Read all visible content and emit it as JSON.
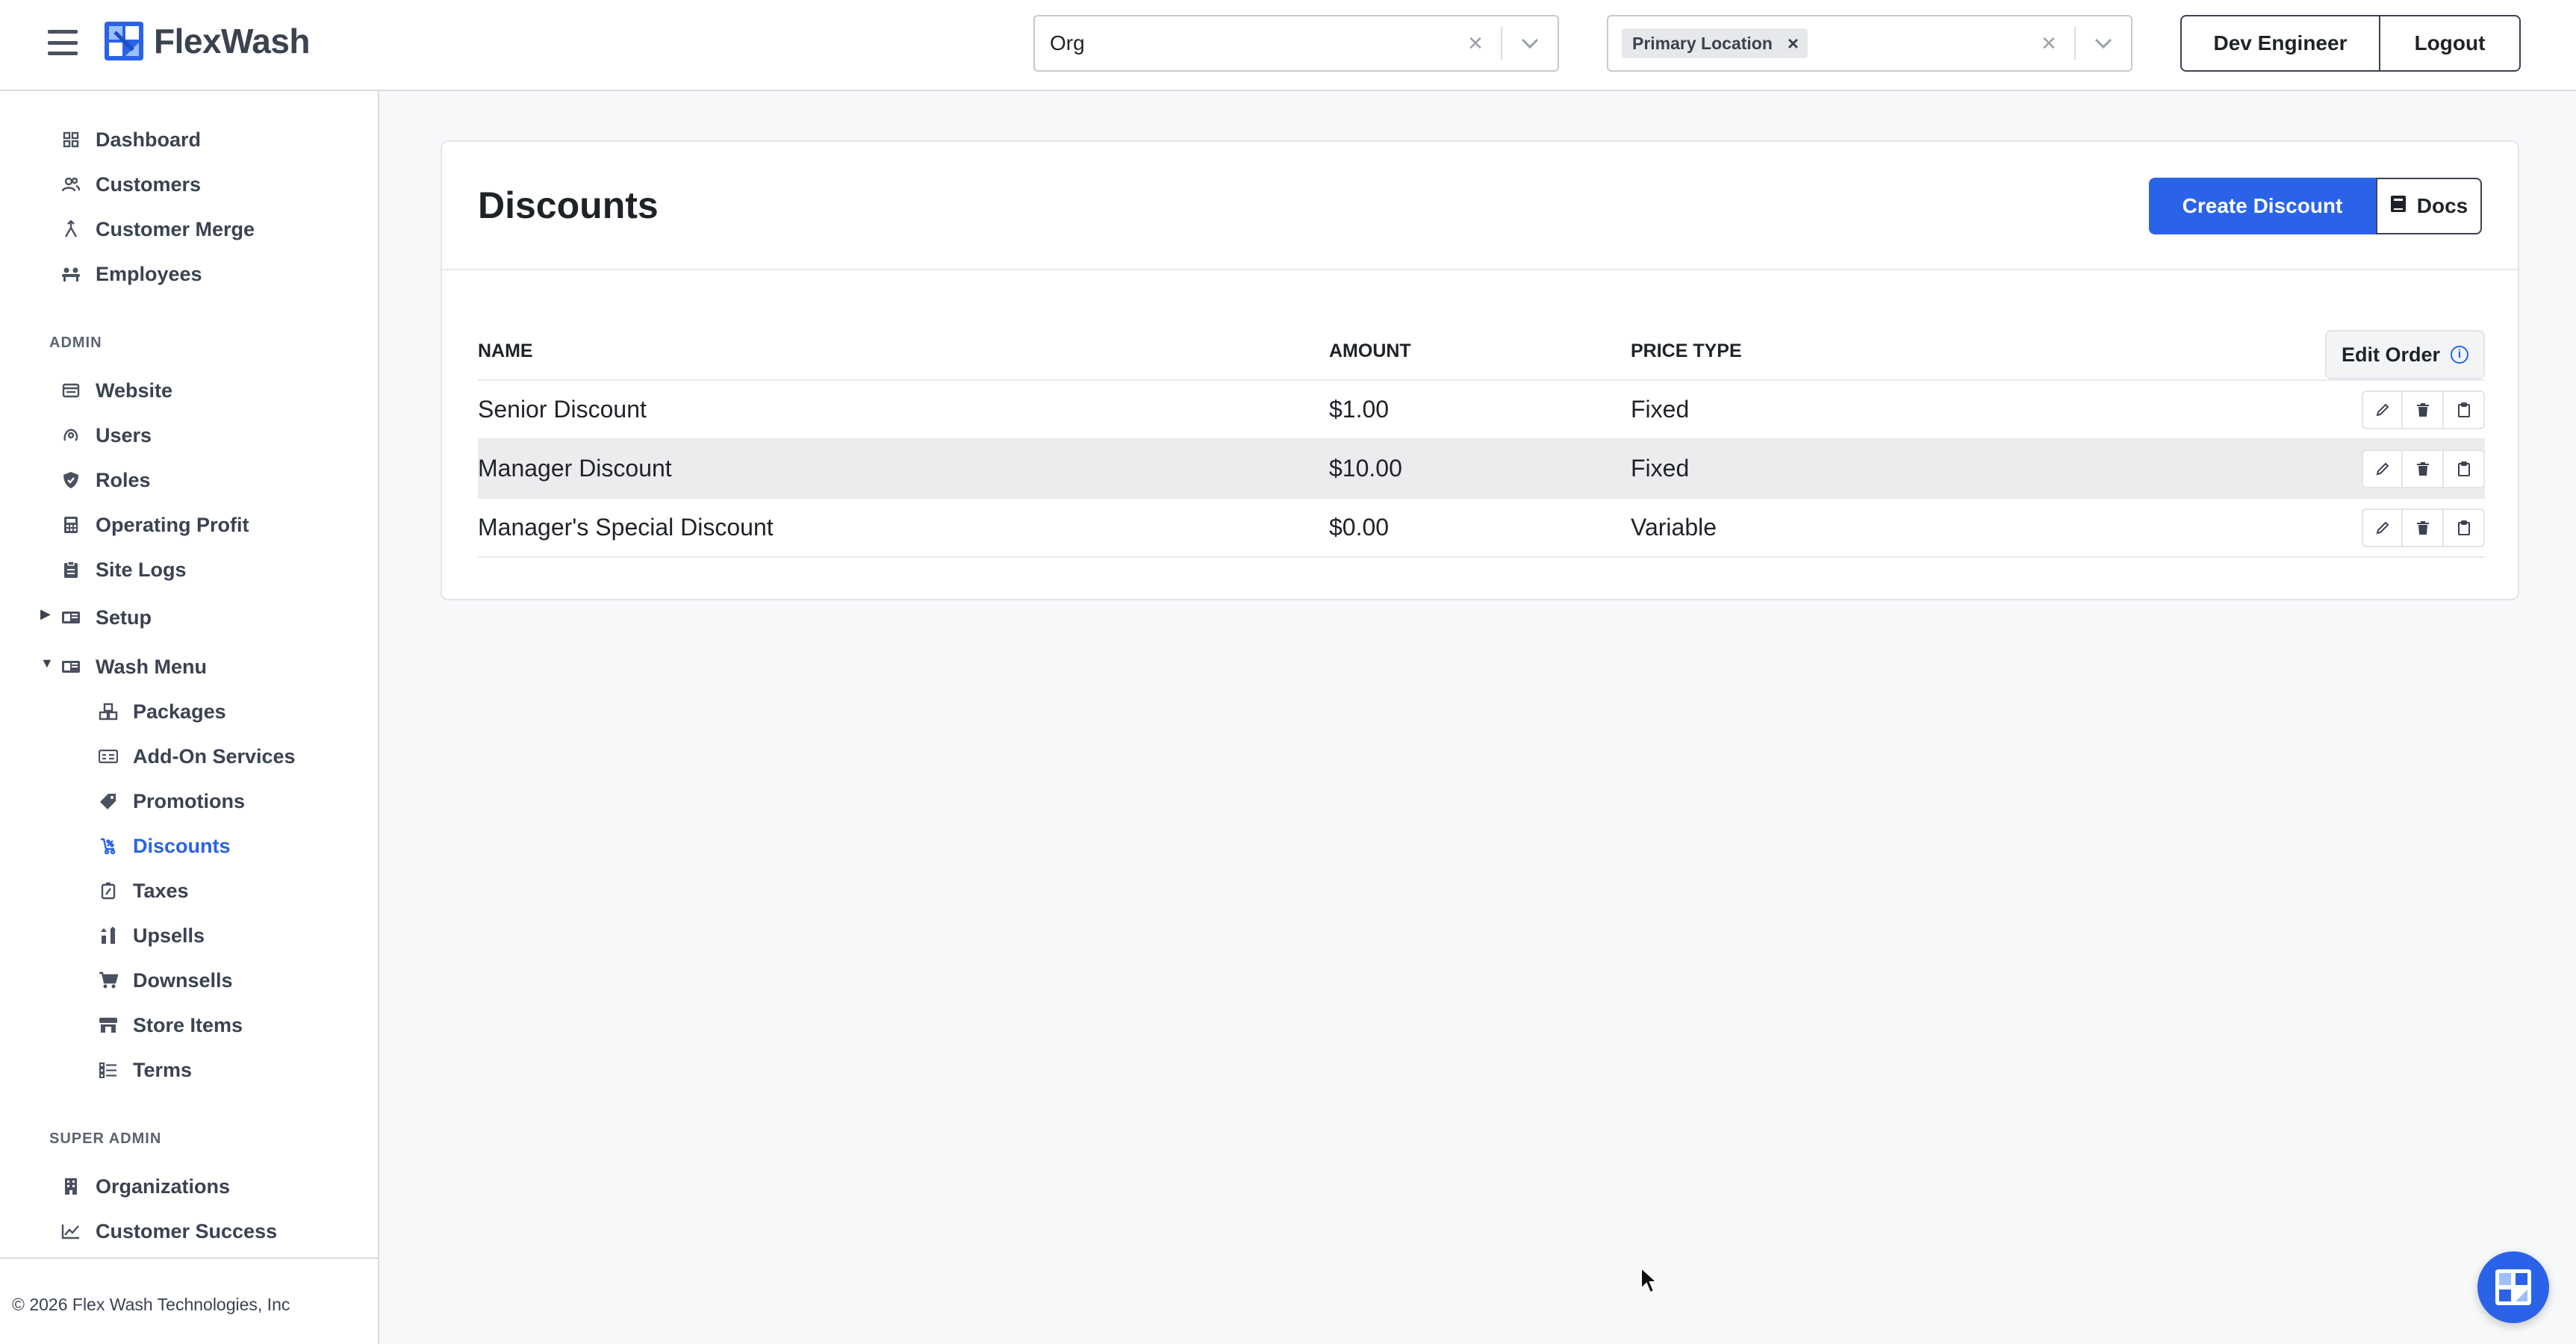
{
  "app": {
    "brand": "FlexWash"
  },
  "header": {
    "org_select": {
      "value": "Org"
    },
    "location_select": {
      "chip": "Primary Location"
    },
    "user_button": "Dev Engineer",
    "logout_button": "Logout"
  },
  "sidebar": {
    "main": [
      {
        "label": "Dashboard",
        "icon": "dashboard-icon"
      },
      {
        "label": "Customers",
        "icon": "customers-icon"
      },
      {
        "label": "Customer Merge",
        "icon": "merge-icon"
      },
      {
        "label": "Employees",
        "icon": "employees-icon"
      }
    ],
    "admin_label": "ADMIN",
    "admin": [
      {
        "label": "Website",
        "icon": "website-icon"
      },
      {
        "label": "Users",
        "icon": "users-icon"
      },
      {
        "label": "Roles",
        "icon": "shield-icon"
      },
      {
        "label": "Operating Profit",
        "icon": "calculator-icon"
      },
      {
        "label": "Site Logs",
        "icon": "clipboard-icon"
      },
      {
        "label": "Setup",
        "icon": "setup-icon",
        "expanded": false
      },
      {
        "label": "Wash Menu",
        "icon": "wash-menu-icon",
        "expanded": true
      }
    ],
    "wash_menu": [
      {
        "label": "Packages",
        "icon": "packages-icon"
      },
      {
        "label": "Add-On Services",
        "icon": "add-on-icon"
      },
      {
        "label": "Promotions",
        "icon": "tag-icon"
      },
      {
        "label": "Discounts",
        "icon": "discount-icon",
        "active": true
      },
      {
        "label": "Taxes",
        "icon": "taxes-icon"
      },
      {
        "label": "Upsells",
        "icon": "upsells-icon"
      },
      {
        "label": "Downsells",
        "icon": "cart-icon"
      },
      {
        "label": "Store Items",
        "icon": "store-icon"
      },
      {
        "label": "Terms",
        "icon": "terms-icon"
      }
    ],
    "super_admin_label": "SUPER ADMIN",
    "super_admin": [
      {
        "label": "Organizations",
        "icon": "building-icon"
      },
      {
        "label": "Customer Success",
        "icon": "chart-line-icon"
      }
    ],
    "footer": "© 2026 Flex Wash Technologies, Inc"
  },
  "page": {
    "title": "Discounts",
    "create_button": "Create Discount",
    "docs_button": "Docs",
    "table": {
      "columns": {
        "name": "NAME",
        "amount": "AMOUNT",
        "price_type": "PRICE TYPE"
      },
      "edit_order": "Edit Order",
      "rows": [
        {
          "name": "Senior Discount",
          "amount": "$1.00",
          "price_type": "Fixed"
        },
        {
          "name": "Manager Discount",
          "amount": "$10.00",
          "price_type": "Fixed"
        },
        {
          "name": "Manager's Special Discount",
          "amount": "$0.00",
          "price_type": "Variable"
        }
      ]
    }
  },
  "colors": {
    "primary": "#2a63e8",
    "text": "#1f2328",
    "muted": "#3b4250",
    "border": "#d9dce1"
  }
}
